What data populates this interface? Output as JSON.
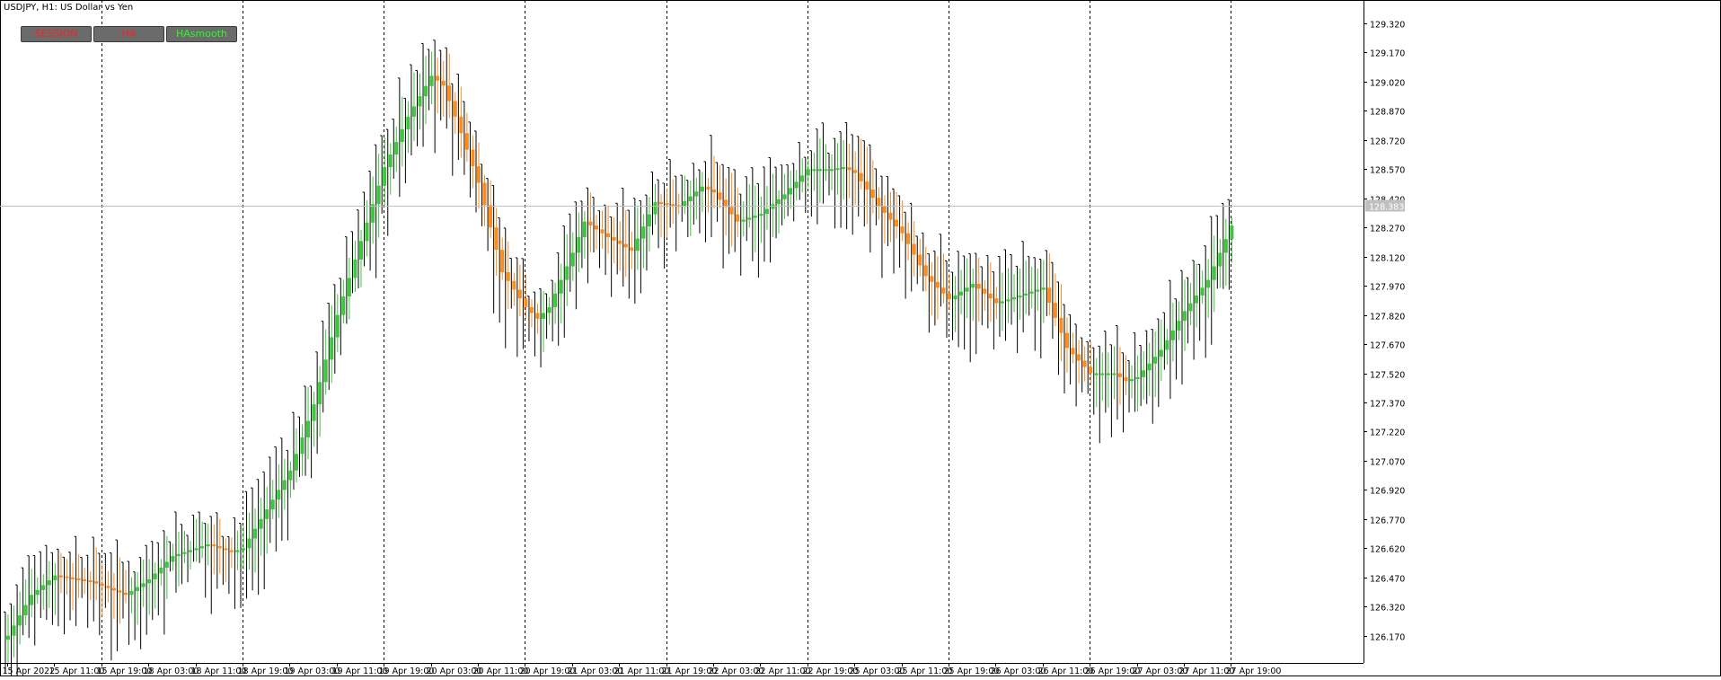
{
  "title": "USDJPY, H1:  US Dollar vs Yen",
  "buttons": [
    {
      "label": "SESSION",
      "color": "#ff2020"
    },
    {
      "label": "HA",
      "color": "#ff2020"
    },
    {
      "label": "HAsmooth",
      "color": "#22ff22"
    }
  ],
  "price_tag": "128.383",
  "colors": {
    "bull": "#3ac93a",
    "bear": "#ff8c1a",
    "raw": "#000000",
    "grid": "#000000",
    "price_line": "#c0c0c0"
  },
  "chart_data": {
    "type": "candlestick",
    "symbol": "USDJPY",
    "timeframe": "H1",
    "ylim": [
      126.03,
      129.44
    ],
    "y_ticks": [
      "129.320",
      "129.170",
      "129.020",
      "128.870",
      "128.720",
      "128.570",
      "128.420",
      "128.270",
      "128.120",
      "127.970",
      "127.820",
      "127.670",
      "127.520",
      "127.370",
      "127.220",
      "127.070",
      "126.920",
      "126.770",
      "126.620",
      "126.470",
      "126.320",
      "126.170"
    ],
    "x_ticks": [
      {
        "label": "15 Apr 2022",
        "bar": 0
      },
      {
        "label": "15 Apr 11:00",
        "bar": 8
      },
      {
        "label": "15 Apr 19:00",
        "bar": 16
      },
      {
        "label": "18 Apr 03:00",
        "bar": 24
      },
      {
        "label": "18 Apr 11:00",
        "bar": 32
      },
      {
        "label": "18 Apr 19:00",
        "bar": 40
      },
      {
        "label": "19 Apr 03:00",
        "bar": 48
      },
      {
        "label": "19 Apr 11:00",
        "bar": 56
      },
      {
        "label": "19 Apr 19:00",
        "bar": 64
      },
      {
        "label": "20 Apr 03:00",
        "bar": 72
      },
      {
        "label": "20 Apr 11:00",
        "bar": 80
      },
      {
        "label": "20 Apr 19:00",
        "bar": 88
      },
      {
        "label": "21 Apr 03:00",
        "bar": 96
      },
      {
        "label": "21 Apr 11:00",
        "bar": 104
      },
      {
        "label": "21 Apr 19:00",
        "bar": 112
      },
      {
        "label": "22 Apr 03:00",
        "bar": 120
      },
      {
        "label": "22 Apr 11:00",
        "bar": 128
      },
      {
        "label": "22 Apr 19:00",
        "bar": 136
      },
      {
        "label": "25 Apr 03:00",
        "bar": 144
      },
      {
        "label": "25 Apr 11:00",
        "bar": 152
      },
      {
        "label": "25 Apr 19:00",
        "bar": 160
      },
      {
        "label": "26 Apr 03:00",
        "bar": 168
      },
      {
        "label": "26 Apr 11:00",
        "bar": 176
      },
      {
        "label": "26 Apr 19:00",
        "bar": 184
      },
      {
        "label": "27 Apr 03:00",
        "bar": 192
      },
      {
        "label": "27 Apr 11:00",
        "bar": 200
      },
      {
        "label": "27 Apr 19:00",
        "bar": 208
      }
    ],
    "session_separator_bars": [
      16,
      40,
      64,
      88,
      112,
      136,
      160,
      184,
      208
    ],
    "current_price": 128.383,
    "ha_close_anchors": [
      [
        0,
        126.17
      ],
      [
        4,
        126.38
      ],
      [
        8,
        126.48
      ],
      [
        14,
        126.45
      ],
      [
        20,
        126.38
      ],
      [
        24,
        126.46
      ],
      [
        28,
        126.58
      ],
      [
        34,
        126.64
      ],
      [
        38,
        126.6
      ],
      [
        40,
        126.62
      ],
      [
        44,
        126.82
      ],
      [
        48,
        127.02
      ],
      [
        52,
        127.36
      ],
      [
        56,
        127.82
      ],
      [
        60,
        128.2
      ],
      [
        64,
        128.58
      ],
      [
        68,
        128.84
      ],
      [
        72,
        129.05
      ],
      [
        74,
        129.0
      ],
      [
        76,
        128.84
      ],
      [
        80,
        128.5
      ],
      [
        84,
        128.04
      ],
      [
        88,
        127.86
      ],
      [
        90,
        127.8
      ],
      [
        92,
        127.86
      ],
      [
        96,
        128.14
      ],
      [
        98,
        128.3
      ],
      [
        102,
        128.22
      ],
      [
        106,
        128.15
      ],
      [
        110,
        128.4
      ],
      [
        114,
        128.38
      ],
      [
        118,
        128.48
      ],
      [
        120,
        128.45
      ],
      [
        124,
        128.3
      ],
      [
        128,
        128.34
      ],
      [
        132,
        128.44
      ],
      [
        136,
        128.57
      ],
      [
        140,
        128.57
      ],
      [
        142,
        128.58
      ],
      [
        144,
        128.55
      ],
      [
        148,
        128.38
      ],
      [
        152,
        128.24
      ],
      [
        156,
        128.02
      ],
      [
        160,
        127.9
      ],
      [
        164,
        127.98
      ],
      [
        168,
        127.88
      ],
      [
        172,
        127.92
      ],
      [
        176,
        127.96
      ],
      [
        180,
        127.65
      ],
      [
        184,
        127.52
      ],
      [
        188,
        127.52
      ],
      [
        190,
        127.48
      ],
      [
        192,
        127.5
      ],
      [
        196,
        127.64
      ],
      [
        200,
        127.84
      ],
      [
        204,
        128.0
      ],
      [
        208,
        128.28
      ]
    ]
  }
}
